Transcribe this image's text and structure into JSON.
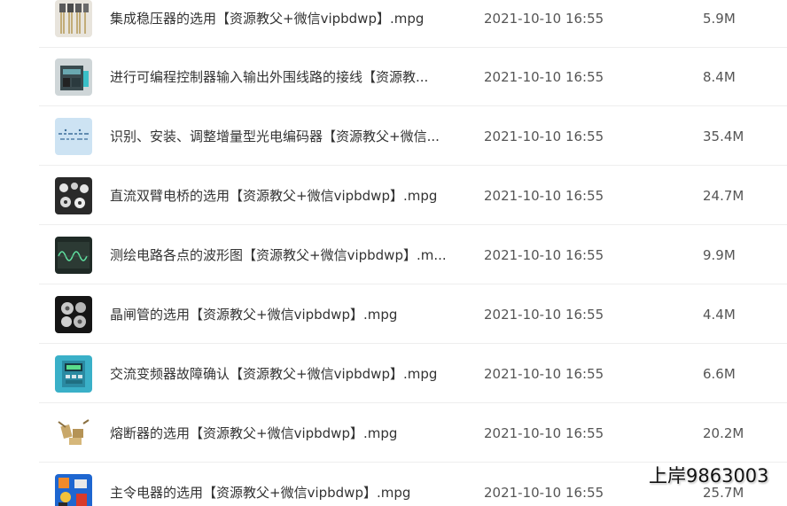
{
  "files": [
    {
      "name": "集成稳压器的选用【资源教父+微信vipbdwp】.mpg",
      "date": "2021-10-10 16:55",
      "size": "5.9M",
      "thumb_icon": "regulator-components-thumbnail"
    },
    {
      "name": "进行可编程控制器输入输出外围线路的接线【资源教...",
      "date": "2021-10-10 16:55",
      "size": "8.4M",
      "thumb_icon": "plc-controller-thumbnail"
    },
    {
      "name": "识别、安装、调整增量型光电编码器【资源教父+微信...",
      "date": "2021-10-10 16:55",
      "size": "35.4M",
      "thumb_icon": "encoder-diagram-thumbnail"
    },
    {
      "name": "直流双臂电桥的选用【资源教父+微信vipbdwp】.mpg",
      "date": "2021-10-10 16:55",
      "size": "24.7M",
      "thumb_icon": "bridge-instrument-thumbnail"
    },
    {
      "name": "测绘电路各点的波形图【资源教父+微信vipbdwp】.m...",
      "date": "2021-10-10 16:55",
      "size": "9.9M",
      "thumb_icon": "oscilloscope-thumbnail"
    },
    {
      "name": "晶闸管的选用【资源教父+微信vipbdwp】.mpg",
      "date": "2021-10-10 16:55",
      "size": "4.4M",
      "thumb_icon": "thyristor-thumbnail"
    },
    {
      "name": "交流变频器故障确认【资源教父+微信vipbdwp】.mpg",
      "date": "2021-10-10 16:55",
      "size": "6.6M",
      "thumb_icon": "inverter-thumbnail"
    },
    {
      "name": "熔断器的选用【资源教父+微信vipbdwp】.mpg",
      "date": "2021-10-10 16:55",
      "size": "20.2M",
      "thumb_icon": "fuse-thumbnail"
    },
    {
      "name": "主令电器的选用【资源教父+微信vipbdwp】.mpg",
      "date": "2021-10-10 16:55",
      "size": "25.7M",
      "thumb_icon": "control-switches-thumbnail"
    }
  ],
  "watermark": "上岸9863003"
}
